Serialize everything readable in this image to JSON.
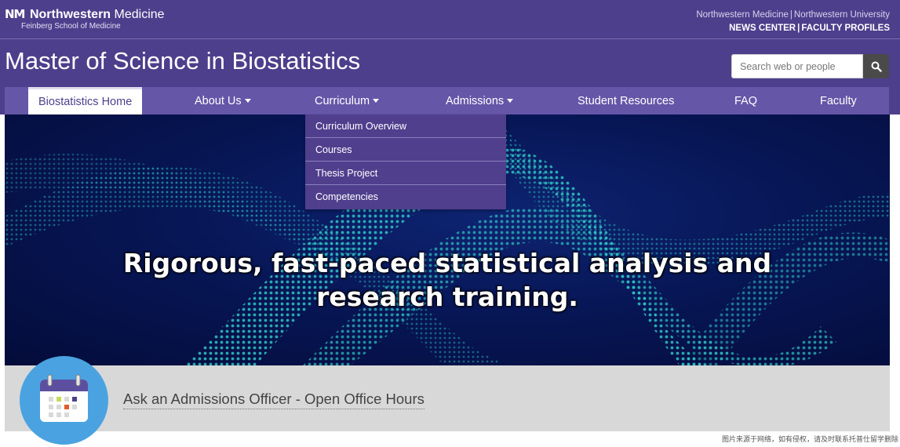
{
  "header": {
    "logo_mark": "NM",
    "logo_brand": "Northwestern",
    "logo_brand_suffix": "Medicine",
    "logo_sub": "Feinberg School of Medicine",
    "toplinks_row1": [
      "Northwestern Medicine",
      "Northwestern University"
    ],
    "toplinks_row2": [
      "NEWS CENTER",
      "FACULTY PROFILES"
    ],
    "separator": "|",
    "site_title": "Master of Science in Biostatistics"
  },
  "search": {
    "placeholder": "Search web or people",
    "button_icon": "search-icon"
  },
  "nav": {
    "items": [
      {
        "label": "Biostatistics Home",
        "active": true,
        "has_caret": false
      },
      {
        "label": "About Us",
        "has_caret": true
      },
      {
        "label": "Curriculum",
        "has_caret": true,
        "open": true
      },
      {
        "label": "Admissions",
        "has_caret": true
      },
      {
        "label": "Student Resources",
        "has_caret": false
      },
      {
        "label": "FAQ",
        "has_caret": false
      },
      {
        "label": "Faculty",
        "has_caret": false
      }
    ]
  },
  "dropdown": {
    "items": [
      "Curriculum Overview",
      "Courses",
      "Thesis Project",
      "Competencies"
    ]
  },
  "hero": {
    "headline_line1": "Rigorous, fast-paced statistical analysis and",
    "headline_line2": "research training."
  },
  "office_hours": {
    "icon": "calendar-icon",
    "link_text": "Ask an Admissions Officer - Open Office Hours"
  },
  "watermark": "图片来源于网络，如有侵权，请及时联系托普仕留学删除",
  "colors": {
    "header_bg": "#4e3f8c",
    "nav_bg": "#6556a8",
    "dropdown_bg": "#4f3f8d",
    "hero_bg": "#071656",
    "wave_teal": "#2ec4c4",
    "calendar_circle": "#4aa3e0",
    "office_bar": "#d8d8d8"
  }
}
